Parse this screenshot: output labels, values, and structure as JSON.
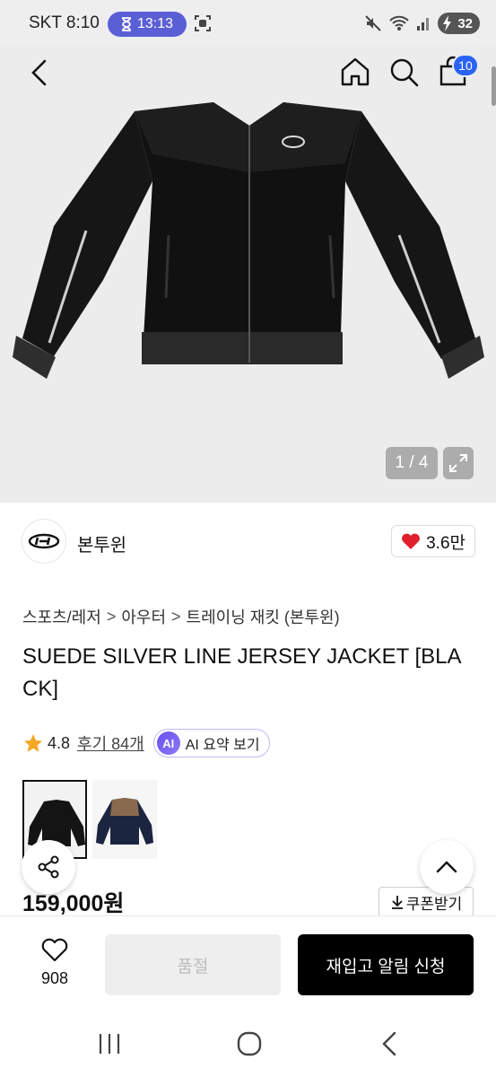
{
  "status_bar": {
    "carrier_time": "SKT 8:10",
    "timer": "13:13",
    "battery": "32"
  },
  "top_nav": {
    "cart_count": "10"
  },
  "gallery": {
    "counter": "1 / 4"
  },
  "brand": {
    "name": "본투윈",
    "likes": "3.6만"
  },
  "breadcrumb": [
    "스포츠/레저",
    "아우터",
    "트레이닝 재킷 (본투윈)"
  ],
  "product": {
    "title": "SUEDE SILVER LINE JERSEY JACKET [BLACK]",
    "rating": "4.8",
    "reviews": "후기 84개",
    "ai_summary": "AI 요약 보기",
    "ai_badge": "AI",
    "price": "159,000원",
    "coupon": "쿠폰받기"
  },
  "action_bar": {
    "wish_count": "908",
    "soldout_label": "품절",
    "restock_label": "재입고 알림 신청"
  },
  "colors": {
    "accent_blue": "#2a63f5",
    "ai_purple": "#6b4df0",
    "heart_red": "#e0202a",
    "star_orange": "#f5a623"
  }
}
